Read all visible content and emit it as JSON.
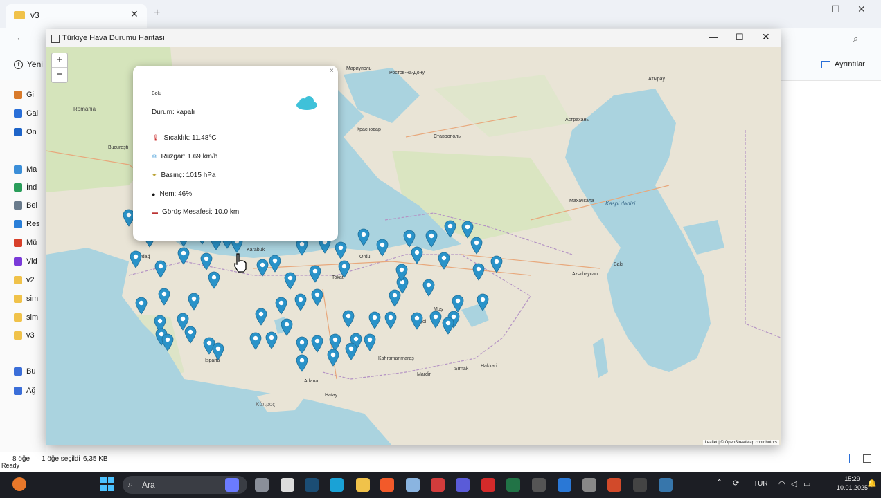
{
  "explorer": {
    "tab_title": "v3",
    "new_button": "Yeni",
    "details_button": "Ayrıntılar",
    "sidebar": [
      {
        "label": "Gi",
        "icon": "home-icon",
        "color": "#d87a2a"
      },
      {
        "label": "Gal",
        "icon": "gallery-icon",
        "color": "#2a6fd8"
      },
      {
        "label": "On",
        "icon": "onedrive-icon",
        "color": "#1e64c8"
      },
      {
        "label": "Ma",
        "icon": "desktop-icon",
        "color": "#3b8ed8"
      },
      {
        "label": "İnd",
        "icon": "download-icon",
        "color": "#2a9d5a"
      },
      {
        "label": "Bel",
        "icon": "documents-icon",
        "color": "#6a7b8c"
      },
      {
        "label": "Res",
        "icon": "pictures-icon",
        "color": "#2a7fd8"
      },
      {
        "label": "Mü",
        "icon": "music-icon",
        "color": "#d8402a"
      },
      {
        "label": "Vid",
        "icon": "videos-icon",
        "color": "#7a3ad8"
      },
      {
        "label": "v2",
        "icon": "folder-icon",
        "color": "#f0c24a"
      },
      {
        "label": "sim",
        "icon": "folder-icon",
        "color": "#f0c24a"
      },
      {
        "label": "sim",
        "icon": "folder-icon",
        "color": "#f0c24a"
      },
      {
        "label": "v3",
        "icon": "folder-icon",
        "color": "#f0c24a"
      },
      {
        "label": "Bu",
        "icon": "pc-icon",
        "color": "#3b6ed8"
      },
      {
        "label": "Ağ",
        "icon": "network-icon",
        "color": "#3b6ed8"
      }
    ],
    "status": {
      "items": "8 öğe",
      "selected": "1 öğe seçildi",
      "size": "6,35 KB"
    },
    "ready": "Ready"
  },
  "map_window": {
    "title": "Türkiye Hava Durumu Haritası",
    "zoom_in": "+",
    "zoom_out": "−",
    "popup": {
      "city": "Bolu",
      "condition": "Durum: kapalı",
      "temperature": "Sıcaklık: 11.48°C",
      "wind": "Rüzgar: 1.69 km/h",
      "pressure": "Basınç: 1015 hPa",
      "humidity": "Nem: 46%",
      "visibility": "Görüş Mesafesi: 10.0 km",
      "close": "×"
    },
    "attribution": "Leaflet | © OpenStreetMap contributors",
    "marker_color": "#2a93c9",
    "labels": {
      "l1": "Tekirdağ",
      "l2": "Ordu",
      "l3": "Tokat",
      "l4": "Bingöl",
      "l5": "Muş",
      "l6": "Mardin",
      "l7": "Şırnak",
      "l8": "Hakkari",
      "l9": "Isparta",
      "l10": "Hatay",
      "l11": "Adana",
      "l12": "Kahramanmaraş",
      "l13": "Karabük",
      "l14": "Azərbaycan",
      "l15": "Bakı",
      "l16": "Ростов-на-Дону",
      "l17": "Краснодар",
      "l18": "Ставрополь",
      "l19": "Астрахань",
      "l20": "Атырау",
      "l21": "Махачкала",
      "l22": "Κύπρος",
      "l23": "Kaspi dənizi",
      "l24": "România",
      "l25": "Bucureşti",
      "l26": "Мариуполь"
    }
  },
  "taskbar": {
    "search": "Ara",
    "lang": "TUR",
    "time": "15:29",
    "date": "10.01.2025"
  }
}
